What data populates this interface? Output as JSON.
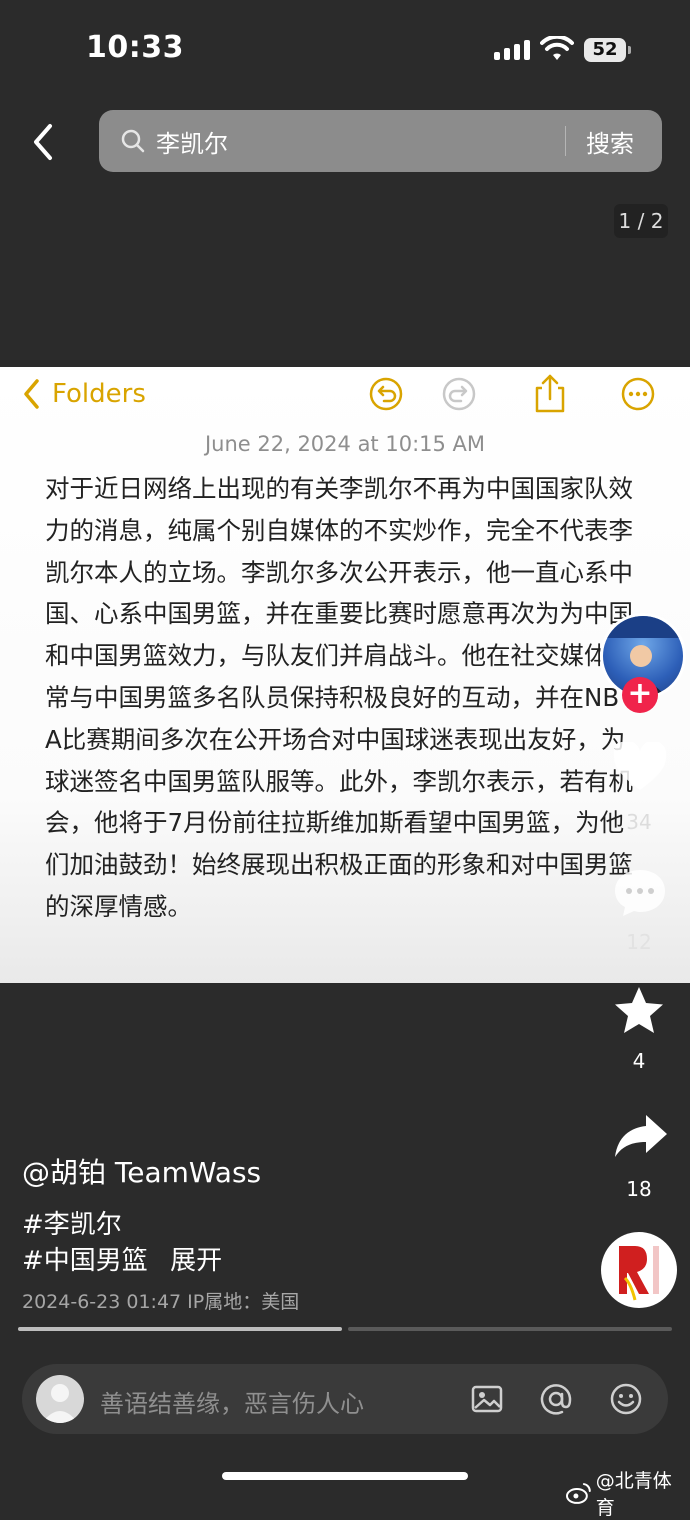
{
  "status_bar": {
    "time": "10:33",
    "battery": "52"
  },
  "search": {
    "query": "李凯尔",
    "button_label": "搜索"
  },
  "page_indicator": "1 / 2",
  "note": {
    "back_label": "Folders",
    "date": "June 22, 2024 at 10:15 AM",
    "body": "对于近日网络上出现的有关李凯尔不再为中国国家队效力的消息，纯属个别自媒体的不实炒作，完全不代表李凯尔本人的立场。李凯尔多次公开表示，他一直心系中国、心系中国男篮，并在重要比赛时愿意再次为为中国和中国男篮效力，与队友们并肩战斗。他在社交媒体上常与中国男篮多名队员保持积极良好的互动，并在NBA比赛期间多次在公开场合对中国球迷表现出友好，为球迷签名中国男篮队服等。此外，李凯尔表示，若有机会，他将于7月份前往拉斯维加斯看望中国男篮，为他们加油鼓劲！始终展现出积极正面的形象和对中国男篮的深厚情感。"
  },
  "actions": {
    "likes": "34",
    "comments": "12",
    "favorites": "4",
    "shares": "18",
    "follow": "+"
  },
  "post": {
    "author": "@胡铂 TeamWass",
    "tags": [
      "#李凯尔",
      "#中国男篮"
    ],
    "expand_label": "展开",
    "meta": "2024-6-23 01:47  IP属地：美国",
    "progress": 0.5
  },
  "comment_bar": {
    "placeholder": "善语结善缘，恶言伤人心"
  },
  "watermark": "@北青体育",
  "colors": {
    "accent_yellow": "#d9a400",
    "follow_red": "#f0244b"
  }
}
